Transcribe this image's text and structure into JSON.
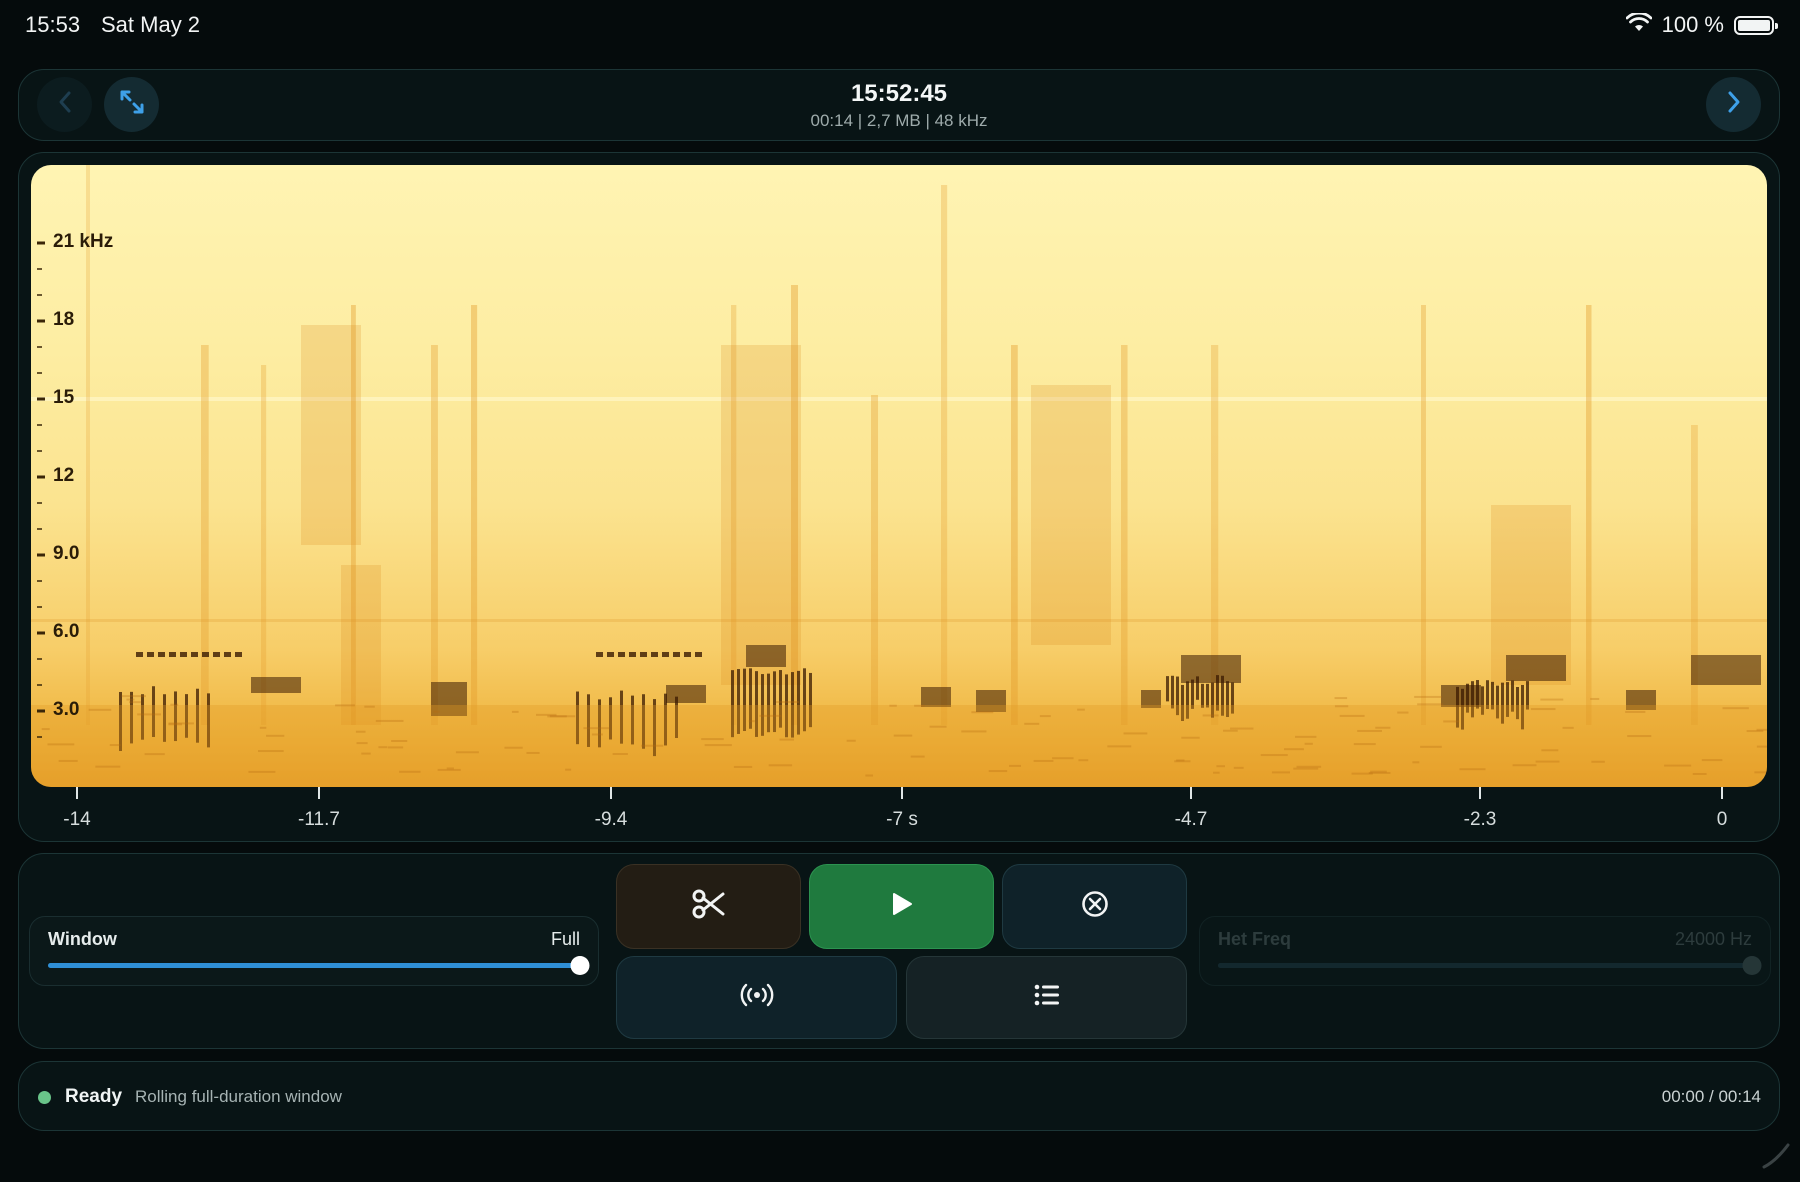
{
  "status_bar": {
    "time": "15:53",
    "date": "Sat May 2",
    "battery": "100 %",
    "icons": [
      "wifi-icon",
      "battery-icon"
    ]
  },
  "header": {
    "title": "15:52:45",
    "subtitle": "00:14 | 2,7 MB | 48 kHz",
    "icons": [
      "chevron-left-icon",
      "expand-arrows-icon",
      "chevron-right-icon"
    ]
  },
  "spectrogram": {
    "y_labels": [
      "21 kHz",
      "18",
      "15",
      "12",
      "9.0",
      "6.0",
      "3.0"
    ],
    "x_labels": [
      "-14",
      "-11.7",
      "-9.4",
      "-7 s",
      "-4.7",
      "-2.3",
      "0"
    ],
    "colors": {
      "low": "#fff4b3",
      "mid": "#f7cd68",
      "high": "#e8a22d",
      "dark": "#3a1a02"
    }
  },
  "controls": {
    "window": {
      "label": "Window",
      "value": "Full",
      "level": 1.0
    },
    "het_freq": {
      "label": "Het Freq",
      "value": "24000 Hz",
      "level": 1.0
    },
    "icons": [
      "scissors-icon",
      "play-icon",
      "cancel-circle-icon",
      "broadcast-icon",
      "list-icon"
    ],
    "colors": {
      "play": "#1f7a3e",
      "slider_fill": "#2f8fd6"
    }
  },
  "status": {
    "state": "Ready",
    "description": "Rolling full-duration window",
    "time": "00:00 / 00:14",
    "dot_color": "#69c489"
  }
}
